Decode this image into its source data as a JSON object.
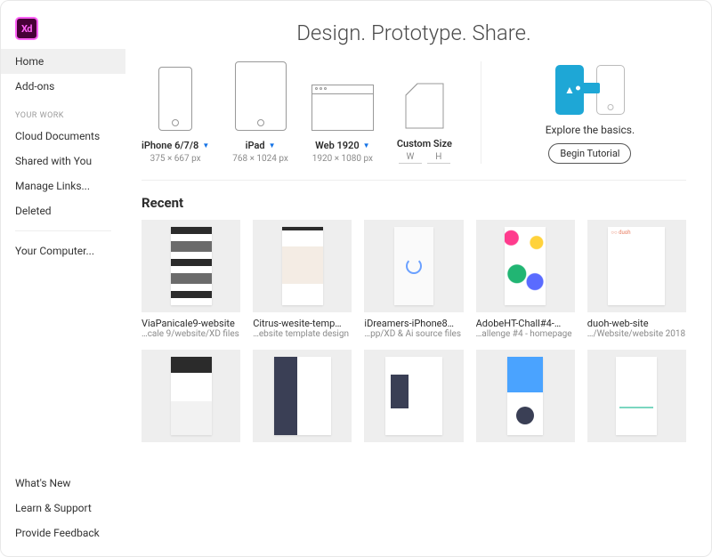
{
  "app": {
    "logo_text": "Xd"
  },
  "sidebar": {
    "primary": [
      {
        "label": "Home",
        "active": true
      },
      {
        "label": "Add-ons",
        "active": false
      }
    ],
    "section_label": "YOUR WORK",
    "work": [
      {
        "label": "Cloud Documents"
      },
      {
        "label": "Shared with You"
      },
      {
        "label": "Manage Links..."
      },
      {
        "label": "Deleted"
      }
    ],
    "computer": {
      "label": "Your Computer..."
    },
    "footer": [
      {
        "label": "What's New"
      },
      {
        "label": "Learn & Support"
      },
      {
        "label": "Provide Feedback"
      }
    ]
  },
  "main": {
    "headline": "Design. Prototype. Share.",
    "presets": [
      {
        "label": "iPhone 6/7/8",
        "dims": "375 × 667 px",
        "kind": "phone",
        "has_menu": true
      },
      {
        "label": "iPad",
        "dims": "768 × 1024 px",
        "kind": "tablet",
        "has_menu": true
      },
      {
        "label": "Web 1920",
        "dims": "1920 × 1080 px",
        "kind": "browser",
        "has_menu": true
      },
      {
        "label": "Custom Size",
        "kind": "custom",
        "has_menu": false,
        "w_label": "W",
        "h_label": "H"
      }
    ],
    "tutorial": {
      "title": "Explore the basics.",
      "button": "Begin Tutorial"
    },
    "recent_title": "Recent",
    "recent": [
      {
        "name": "ViaPanicale9-website",
        "path": "…cale 9/website/XD files"
      },
      {
        "name": "Citrus-wesite-temp…",
        "path": "…ebsite template design"
      },
      {
        "name": "iDreamers-iPhone8…",
        "path": "…pp/XD & Ai source files"
      },
      {
        "name": "AdobeHT-Chall#4-…",
        "path": "…allenge #4 - homepage"
      },
      {
        "name": "duoh-web-site",
        "path": "…/Website/website 2018"
      },
      {
        "name": "",
        "path": ""
      },
      {
        "name": "",
        "path": ""
      },
      {
        "name": "",
        "path": ""
      },
      {
        "name": "",
        "path": ""
      },
      {
        "name": "",
        "path": ""
      }
    ]
  }
}
